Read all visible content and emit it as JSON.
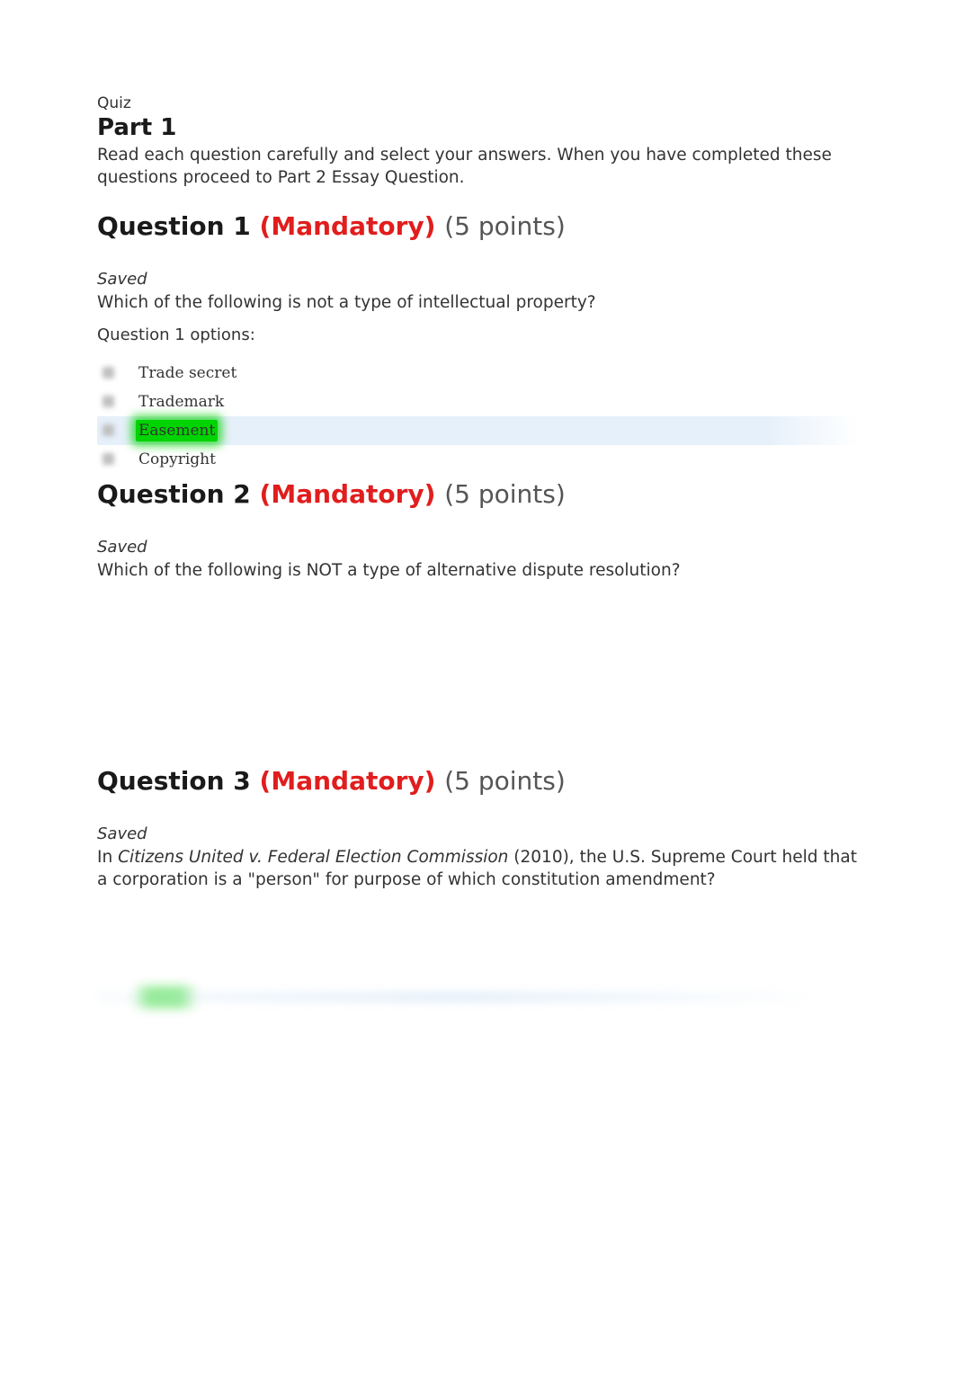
{
  "header": {
    "quiz_label": "Quiz",
    "part_heading": "Part 1",
    "instructions": "Read each question carefully and select your answers. When you have completed these questions proceed to Part 2 Essay Question."
  },
  "questions": [
    {
      "number": "Question 1",
      "mandatory": "(Mandatory)",
      "points": "(5 points)",
      "saved": "Saved",
      "text": "Which of the following is not a type of intellectual property?",
      "options_label": "Question 1 options:",
      "options": [
        {
          "text": "Trade secret",
          "selected": false,
          "highlighted": false
        },
        {
          "text": "Trademark",
          "selected": false,
          "highlighted": false
        },
        {
          "text": "Easement",
          "selected": true,
          "highlighted": true
        },
        {
          "text": "Copyright",
          "selected": false,
          "highlighted": false
        }
      ]
    },
    {
      "number": "Question 2",
      "mandatory": "(Mandatory)",
      "points": "(5 points)",
      "saved": "Saved",
      "text": "Which of the following is NOT a type of alternative dispute resolution?"
    },
    {
      "number": "Question 3",
      "mandatory": "(Mandatory)",
      "points": "(5 points)",
      "saved": "Saved",
      "text_prefix": "In ",
      "case": "Citizens United v. Federal Election Commission",
      "text_suffix": " (2010), the U.S. Supreme Court held that a corporation is a \"person\" for purpose of which constitution amendment?"
    }
  ]
}
